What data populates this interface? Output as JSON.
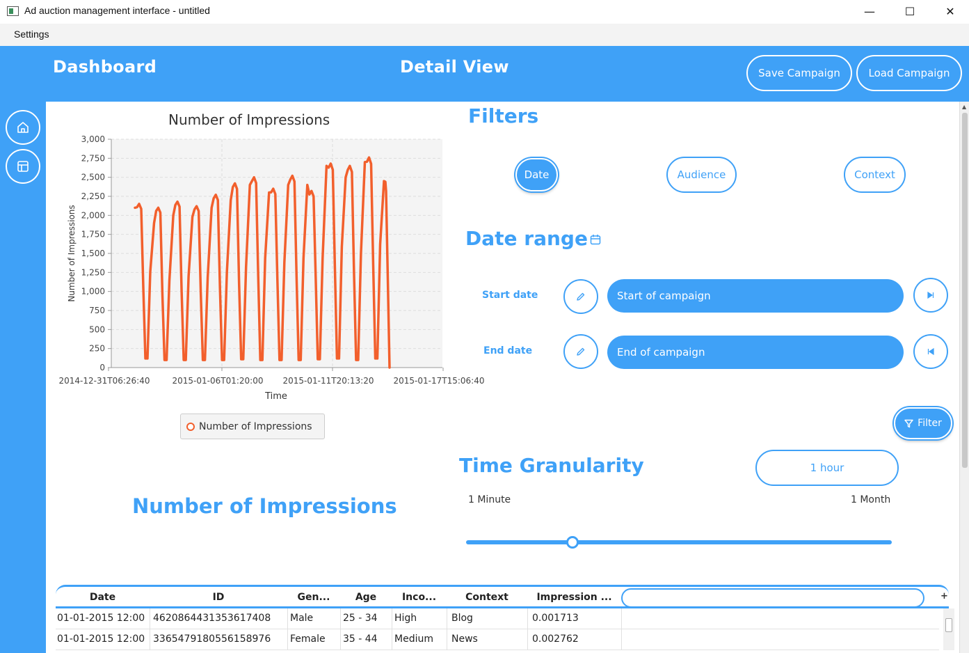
{
  "window": {
    "title": "Ad auction management interface - untitled",
    "minimize": "—",
    "maximize": "☐",
    "close": "✕"
  },
  "menu": {
    "settings": "Settings"
  },
  "header": {
    "dashboard": "Dashboard",
    "detail_view": "Detail View",
    "save_campaign": "Save Campaign",
    "load_campaign": "Load Campaign"
  },
  "sidebar": {
    "items": [
      "home-icon",
      "layout-icon"
    ]
  },
  "chart_data": {
    "type": "line",
    "title": "Number of Impressions",
    "xlabel": "Time",
    "ylabel": "Number of Impressions",
    "ylim": [
      0,
      3000
    ],
    "yticks": [
      "3,000",
      "2,750",
      "2,500",
      "2,250",
      "2,000",
      "1,750",
      "1,500",
      "1,250",
      "1,000",
      "750",
      "500",
      "250",
      "0"
    ],
    "xticks": [
      "2014-12-31T06:26:40",
      "2015-01-06T01:20:00",
      "2015-01-11T20:13:20",
      "2015-01-17T15:06:40"
    ],
    "grid": true,
    "legend_position": "bottom",
    "series": [
      {
        "name": "Number of Impressions",
        "color": "#f25f2c",
        "days": [
          {
            "start": 2100,
            "peak": 2150,
            "low": 120
          },
          {
            "start": 1900,
            "peak": 2100,
            "low": 100
          },
          {
            "start": 2000,
            "peak": 2180,
            "low": 100
          },
          {
            "start": 1980,
            "peak": 2120,
            "low": 100
          },
          {
            "start": 2100,
            "peak": 2270,
            "low": 100
          },
          {
            "start": 2200,
            "peak": 2420,
            "low": 110
          },
          {
            "start": 2400,
            "peak": 2500,
            "low": 100
          },
          {
            "start": 2300,
            "peak": 2350,
            "low": 100
          },
          {
            "start": 2400,
            "peak": 2520,
            "low": 100
          },
          {
            "start": 2400,
            "peak": 2320,
            "low": 110
          },
          {
            "start": 2650,
            "peak": 2680,
            "low": 120
          },
          {
            "start": 2500,
            "peak": 2650,
            "low": 100
          },
          {
            "start": 2700,
            "peak": 2760,
            "low": 120
          },
          {
            "start": 2450,
            "peak": 2440,
            "low": 0
          }
        ]
      }
    ]
  },
  "filters": {
    "heading": "Filters",
    "tabs": [
      "Date",
      "Audience",
      "Context"
    ],
    "active_tab": "Date"
  },
  "date_range": {
    "heading": "Date range",
    "start_label": "Start date",
    "start_value": "Start of campaign",
    "end_label": "End date",
    "end_value": "End of campaign",
    "filter_button": "Filter"
  },
  "granularity": {
    "heading": "Time Granularity",
    "value": "1 hour",
    "min_label": "1 Minute",
    "max_label": "1 Month",
    "slider_fraction": 0.25
  },
  "metric_heading": "Number of Impressions",
  "table": {
    "columns": [
      "Date",
      "ID",
      "Gen...",
      "Age",
      "Inco...",
      "Context",
      "Impression ..."
    ],
    "add_column": "+",
    "rows": [
      [
        "01-01-2015 12:00",
        "4620864431353617408",
        "Male",
        "25 - 34",
        "High",
        "Blog",
        "0.001713"
      ],
      [
        "01-01-2015 12:00",
        "3365479180556158976",
        "Female",
        "35 - 44",
        "Medium",
        "News",
        "0.002762"
      ]
    ]
  },
  "colors": {
    "accent": "#3fa1f7",
    "series": "#f25f2c"
  }
}
